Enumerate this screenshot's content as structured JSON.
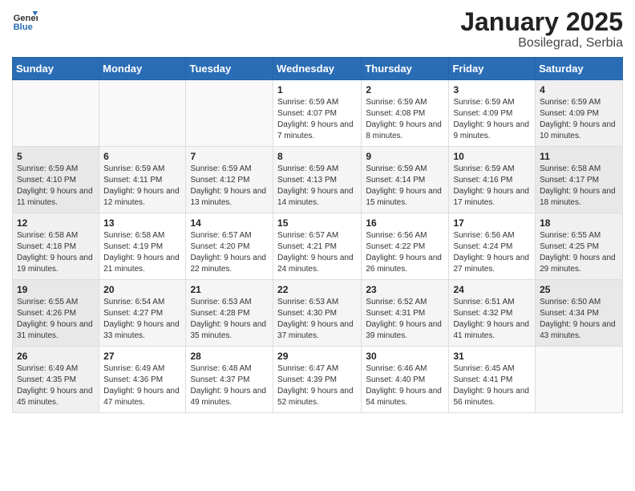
{
  "header": {
    "logo_general": "General",
    "logo_blue": "Blue",
    "main_title": "January 2025",
    "subtitle": "Bosilegrad, Serbia"
  },
  "calendar": {
    "days_of_week": [
      "Sunday",
      "Monday",
      "Tuesday",
      "Wednesday",
      "Thursday",
      "Friday",
      "Saturday"
    ],
    "weeks": [
      [
        {
          "day": "",
          "info": ""
        },
        {
          "day": "",
          "info": ""
        },
        {
          "day": "",
          "info": ""
        },
        {
          "day": "1",
          "info": "Sunrise: 6:59 AM\nSunset: 4:07 PM\nDaylight: 9 hours and 7 minutes."
        },
        {
          "day": "2",
          "info": "Sunrise: 6:59 AM\nSunset: 4:08 PM\nDaylight: 9 hours and 8 minutes."
        },
        {
          "day": "3",
          "info": "Sunrise: 6:59 AM\nSunset: 4:09 PM\nDaylight: 9 hours and 9 minutes."
        },
        {
          "day": "4",
          "info": "Sunrise: 6:59 AM\nSunset: 4:09 PM\nDaylight: 9 hours and 10 minutes."
        }
      ],
      [
        {
          "day": "5",
          "info": "Sunrise: 6:59 AM\nSunset: 4:10 PM\nDaylight: 9 hours and 11 minutes."
        },
        {
          "day": "6",
          "info": "Sunrise: 6:59 AM\nSunset: 4:11 PM\nDaylight: 9 hours and 12 minutes."
        },
        {
          "day": "7",
          "info": "Sunrise: 6:59 AM\nSunset: 4:12 PM\nDaylight: 9 hours and 13 minutes."
        },
        {
          "day": "8",
          "info": "Sunrise: 6:59 AM\nSunset: 4:13 PM\nDaylight: 9 hours and 14 minutes."
        },
        {
          "day": "9",
          "info": "Sunrise: 6:59 AM\nSunset: 4:14 PM\nDaylight: 9 hours and 15 minutes."
        },
        {
          "day": "10",
          "info": "Sunrise: 6:59 AM\nSunset: 4:16 PM\nDaylight: 9 hours and 17 minutes."
        },
        {
          "day": "11",
          "info": "Sunrise: 6:58 AM\nSunset: 4:17 PM\nDaylight: 9 hours and 18 minutes."
        }
      ],
      [
        {
          "day": "12",
          "info": "Sunrise: 6:58 AM\nSunset: 4:18 PM\nDaylight: 9 hours and 19 minutes."
        },
        {
          "day": "13",
          "info": "Sunrise: 6:58 AM\nSunset: 4:19 PM\nDaylight: 9 hours and 21 minutes."
        },
        {
          "day": "14",
          "info": "Sunrise: 6:57 AM\nSunset: 4:20 PM\nDaylight: 9 hours and 22 minutes."
        },
        {
          "day": "15",
          "info": "Sunrise: 6:57 AM\nSunset: 4:21 PM\nDaylight: 9 hours and 24 minutes."
        },
        {
          "day": "16",
          "info": "Sunrise: 6:56 AM\nSunset: 4:22 PM\nDaylight: 9 hours and 26 minutes."
        },
        {
          "day": "17",
          "info": "Sunrise: 6:56 AM\nSunset: 4:24 PM\nDaylight: 9 hours and 27 minutes."
        },
        {
          "day": "18",
          "info": "Sunrise: 6:55 AM\nSunset: 4:25 PM\nDaylight: 9 hours and 29 minutes."
        }
      ],
      [
        {
          "day": "19",
          "info": "Sunrise: 6:55 AM\nSunset: 4:26 PM\nDaylight: 9 hours and 31 minutes."
        },
        {
          "day": "20",
          "info": "Sunrise: 6:54 AM\nSunset: 4:27 PM\nDaylight: 9 hours and 33 minutes."
        },
        {
          "day": "21",
          "info": "Sunrise: 6:53 AM\nSunset: 4:28 PM\nDaylight: 9 hours and 35 minutes."
        },
        {
          "day": "22",
          "info": "Sunrise: 6:53 AM\nSunset: 4:30 PM\nDaylight: 9 hours and 37 minutes."
        },
        {
          "day": "23",
          "info": "Sunrise: 6:52 AM\nSunset: 4:31 PM\nDaylight: 9 hours and 39 minutes."
        },
        {
          "day": "24",
          "info": "Sunrise: 6:51 AM\nSunset: 4:32 PM\nDaylight: 9 hours and 41 minutes."
        },
        {
          "day": "25",
          "info": "Sunrise: 6:50 AM\nSunset: 4:34 PM\nDaylight: 9 hours and 43 minutes."
        }
      ],
      [
        {
          "day": "26",
          "info": "Sunrise: 6:49 AM\nSunset: 4:35 PM\nDaylight: 9 hours and 45 minutes."
        },
        {
          "day": "27",
          "info": "Sunrise: 6:49 AM\nSunset: 4:36 PM\nDaylight: 9 hours and 47 minutes."
        },
        {
          "day": "28",
          "info": "Sunrise: 6:48 AM\nSunset: 4:37 PM\nDaylight: 9 hours and 49 minutes."
        },
        {
          "day": "29",
          "info": "Sunrise: 6:47 AM\nSunset: 4:39 PM\nDaylight: 9 hours and 52 minutes."
        },
        {
          "day": "30",
          "info": "Sunrise: 6:46 AM\nSunset: 4:40 PM\nDaylight: 9 hours and 54 minutes."
        },
        {
          "day": "31",
          "info": "Sunrise: 6:45 AM\nSunset: 4:41 PM\nDaylight: 9 hours and 56 minutes."
        },
        {
          "day": "",
          "info": ""
        }
      ]
    ]
  }
}
